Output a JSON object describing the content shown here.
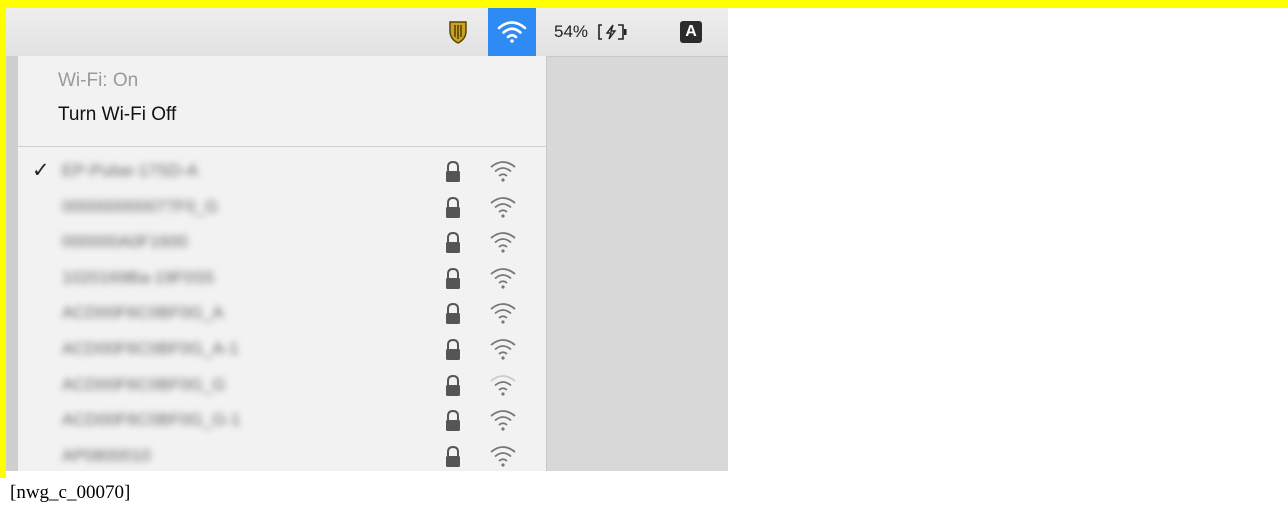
{
  "menubar": {
    "icons": [
      "shield-icon",
      "wifi-icon",
      "battery-charging-icon",
      "input-source-icon"
    ],
    "battery_percent": "54%",
    "input_source_label": "A",
    "wifi_active_color": "#2d8bf3"
  },
  "wifi_menu": {
    "status": "Wi-Fi: On",
    "toggle_label": "Turn Wi-Fi Off",
    "networks": [
      {
        "name": "EP-Pulse-17SD-A",
        "selected": true,
        "secured": true
      },
      {
        "name": "000000000077F0_G",
        "selected": false,
        "secured": true
      },
      {
        "name": "000000A0F1600",
        "selected": false,
        "secured": true
      },
      {
        "name": "1020169Ba-19F0S5",
        "selected": false,
        "secured": true
      },
      {
        "name": "ACD00F6C0BF0G_A",
        "selected": false,
        "secured": true
      },
      {
        "name": "ACD00F6C0BF0G_A-1",
        "selected": false,
        "secured": true
      },
      {
        "name": "ACD00F6C0BF0G_G",
        "selected": false,
        "secured": true
      },
      {
        "name": "ACD00F6C0BF0G_G-1",
        "selected": false,
        "secured": true
      },
      {
        "name": "AP0800010",
        "selected": false,
        "secured": true
      }
    ],
    "check_glyph": "✓"
  },
  "caption": "[nwg_c_00070]"
}
